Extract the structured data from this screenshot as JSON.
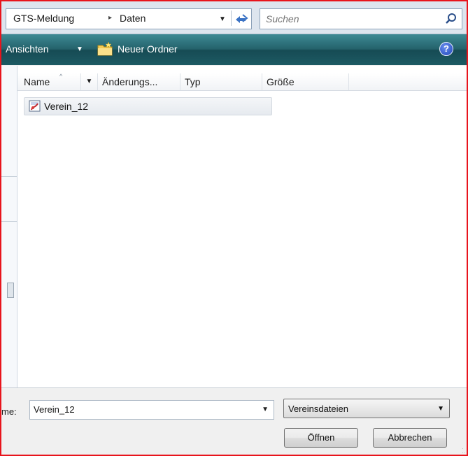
{
  "address_bar": {
    "crumbs": [
      "GTS-Meldung",
      "Daten"
    ],
    "separator": "▸",
    "dropdown": "▼",
    "search_placeholder": "Suchen"
  },
  "toolbar": {
    "views_label": "Ansichten",
    "views_caret": "▼",
    "new_folder_label": "Neuer Ordner",
    "help_label": "?"
  },
  "columns": {
    "name": "Name",
    "sort_indicator": "^",
    "name_dropdown": "▼",
    "date": "Änderungs...",
    "type": "Typ",
    "size": "Größe"
  },
  "files": [
    {
      "name": "Verein_12"
    }
  ],
  "bottom": {
    "filename_label": "me:",
    "filename_value": "Verein_12",
    "filename_dropdown": "▼",
    "filetype_value": "Vereinsdateien",
    "filetype_dropdown": "▼",
    "open_label": "Öffnen",
    "cancel_label": "Abbrechen"
  }
}
